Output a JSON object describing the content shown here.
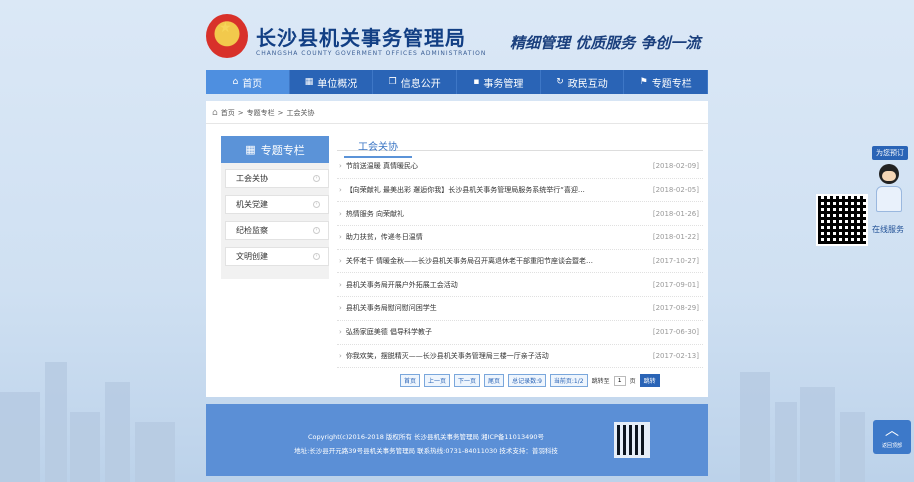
{
  "header": {
    "title": "长沙县机关事务管理局",
    "subtitle": "CHANGSHA COUNTY GOVERMENT OFFICES ADMINISTRATION",
    "slogan": "精细管理  优质服务  争创一流"
  },
  "nav": [
    {
      "label": "首页",
      "icon": "home-icon",
      "active": true
    },
    {
      "label": "单位概况",
      "icon": "building-icon"
    },
    {
      "label": "信息公开",
      "icon": "book-icon"
    },
    {
      "label": "事务管理",
      "icon": "grid-icon"
    },
    {
      "label": "政民互动",
      "icon": "refresh-icon"
    },
    {
      "label": "专题专栏",
      "icon": "flag-icon"
    }
  ],
  "breadcrumb": [
    "首页",
    "专题专栏",
    "工会关协"
  ],
  "sidebar": {
    "title": "专题专栏",
    "items": [
      "工会关协",
      "机关党建",
      "纪检监察",
      "文明创建"
    ]
  },
  "content": {
    "title": "工会关协",
    "items": [
      {
        "title": "节前送温暖 真情暖民心",
        "date": "[2018-02-09]"
      },
      {
        "title": "【向荣献礼 最美出彩 邂逅你我】长沙县机关事务管理局服务系统举行“喜迎…",
        "date": "[2018-02-05]"
      },
      {
        "title": "热情服务 向荣献礼",
        "date": "[2018-01-26]"
      },
      {
        "title": "助力扶贫，传递冬日温情",
        "date": "[2018-01-22]"
      },
      {
        "title": "关怀老干 情暖金秋——长沙县机关事务局召开离退休老干部重阳节座谈会暨老…",
        "date": "[2017-10-27]"
      },
      {
        "title": "县机关事务局开展户外拓展工会活动",
        "date": "[2017-09-01]"
      },
      {
        "title": "县机关事务局慰问慰问困学生",
        "date": "[2017-08-29]"
      },
      {
        "title": "弘扬家庭美德 倡导科学教子",
        "date": "[2017-06-30]"
      },
      {
        "title": "你我欢笑，摆脱精灭——长沙县机关事务管理局三楼一厅亲子活动",
        "date": "[2017-02-13]"
      }
    ]
  },
  "pager": {
    "first": "首页",
    "prev": "上一页",
    "next": "下一页",
    "last": "尾页",
    "total": "总记录数:9",
    "current": "当前页:1/2",
    "goto_label": "跳转至",
    "page_value": "1",
    "page_unit": "页",
    "go": "跳转"
  },
  "footer": {
    "copyright": "Copyright(c)2016-2018 版权所有 长沙县机关事务管理局 湘ICP备11013490号",
    "address": "地址:长沙县开元路39号县机关事务管理局 联系热线:0731-84011030 技术支持：普羽科技"
  },
  "float_service": {
    "tag": "为您预订",
    "label": "在线服务"
  },
  "back_top": "返回顶部"
}
